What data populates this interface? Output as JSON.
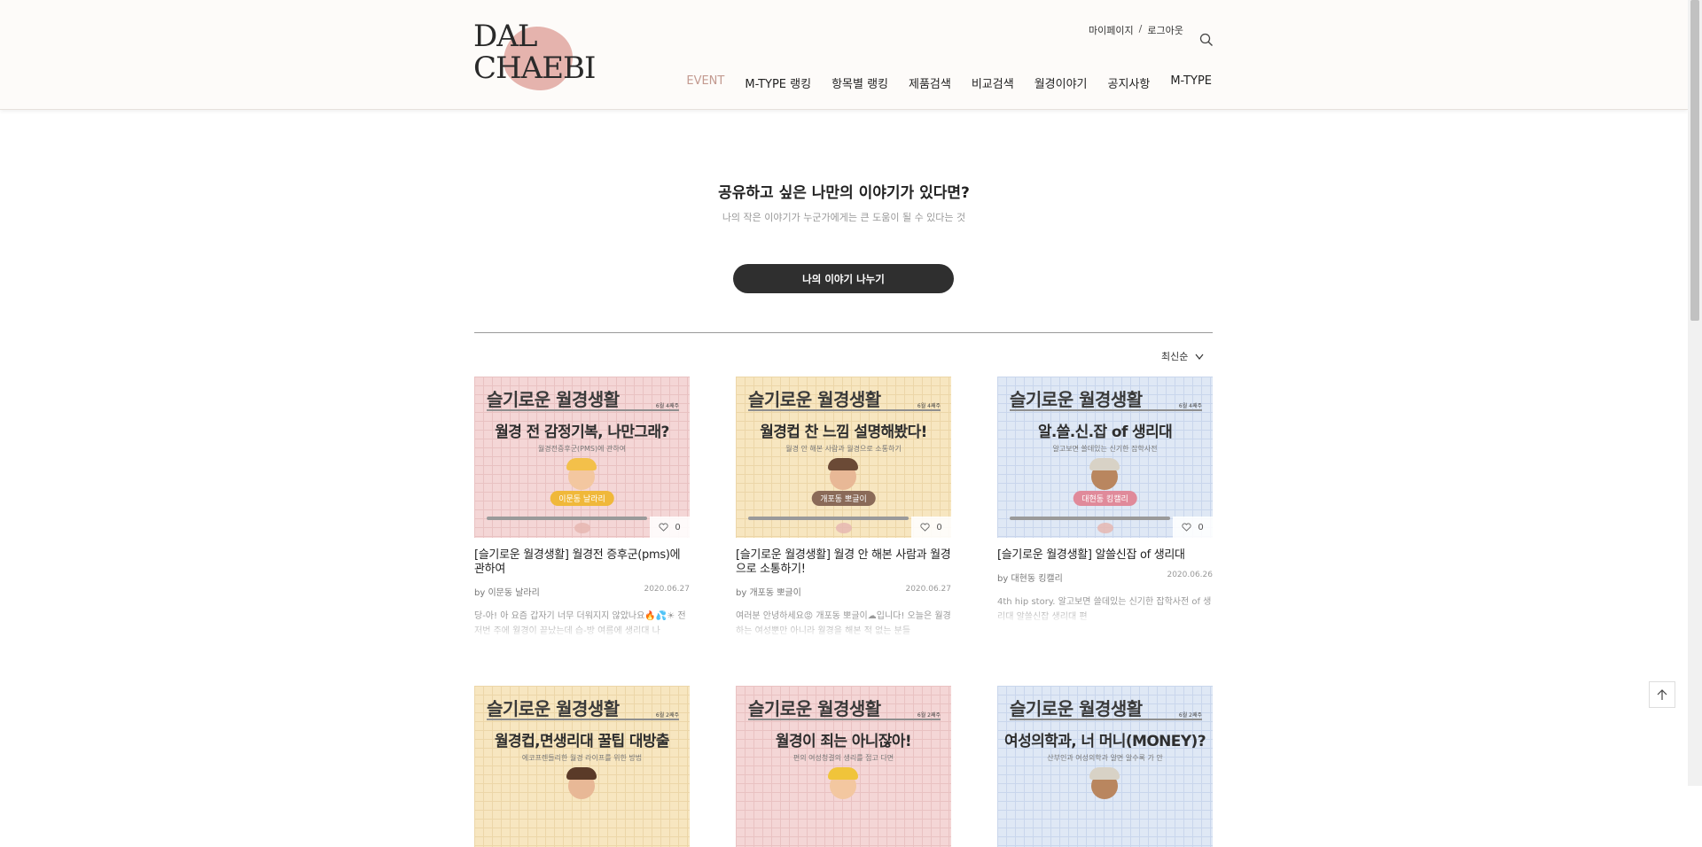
{
  "brand": {
    "logo_line1": "DAL",
    "logo_line2": "CHAEBI",
    "accent": "#c39a90",
    "logo_blob": "#e5b3ad"
  },
  "top_links": {
    "mypage": "마이페이지",
    "separator": "/",
    "logout": "로그아웃"
  },
  "nav": [
    {
      "label": "EVENT",
      "active": true
    },
    {
      "label": "M-TYPE 랭킹"
    },
    {
      "label": "항목별 랭킹"
    },
    {
      "label": "제품검색"
    },
    {
      "label": "비교검색"
    },
    {
      "label": "월경이야기"
    },
    {
      "label": "공지사항"
    },
    {
      "label": "M-TYPE"
    }
  ],
  "hero": {
    "title": "공유하고 싶은 나만의 이야기가 있다면?",
    "subtitle": "나의 작은 이야기가 누군가에게는 큰 도움이 될 수 있다는 것",
    "button": "나의 이야기 나누기"
  },
  "sort": {
    "label": "최신순"
  },
  "cards": [
    {
      "theme": "pink",
      "series": "슬기로운 월경생활",
      "week": "6월 4째주",
      "headline": "월경 전 감정기복, 나만그래?",
      "sub": "월경전증후군(PMS)에 관하여",
      "tag": "이문동 날라리",
      "tag_color": "#f0b83a",
      "avatar_color": "#f3c04a",
      "likes": "0",
      "title": "[슬기로운 월경생활] 월경전 증후군(pms)에 관하여",
      "author": "by 이문동 날라리",
      "date": "2020.06.27",
      "excerpt": "당-아! 아 요즘 갑자기 너무 더워지지 않았나요🔥💦☀ 전 저번 주에 월경이 끝났는데 습-방 여름에 생리대 나"
    },
    {
      "theme": "yellow",
      "series": "슬기로운 월경생활",
      "week": "6월 4째주",
      "headline": "월경컵 찬 느낌 설명해봤다!",
      "sub": "월경 안 해본 사람과 월경으로 소통하기",
      "tag": "개포동 뽀글이",
      "tag_color": "#8a6a58",
      "avatar_color": "#6b4a36",
      "likes": "0",
      "title": "[슬기로운 월경생활] 월경 안 해본 사람과 월경으로 소통하기!",
      "author": "by 개포동 뽀글이",
      "date": "2020.06.27",
      "excerpt": "여러분 안녕하세요😡 개포동 뽀글이☁입니다! 오늘은 월경하는 여성뿐만 아니라 월경을 해본 적 없는 분들"
    },
    {
      "theme": "blue",
      "series": "슬기로운 월경생활",
      "week": "6월 4째주",
      "headline": "알.쓸.신.잡 of 생리대",
      "sub": "알고보면 쓸데있는 신기한 잡학사전",
      "tag": "대현동 킹캘리",
      "tag_color": "#e08a9a",
      "avatar_color": "#d8d2c6",
      "likes": "0",
      "title": "[슬기로운 월경생활] 알쓸신잡 of 생리대",
      "author": "by 대현동 킹캘리",
      "date": "2020.06.26",
      "excerpt": "4th hip story. 알고보면 쓸데있는 신기한 잡학사전 of 생리대 알쓸신잡 생리대 편"
    },
    {
      "theme": "yellow",
      "series": "슬기로운 월경생활",
      "week": "6월 2째주",
      "headline": "월경컵,면생리대 꿀팁 대방출",
      "sub": "에코프렌들리한 월경 라이프를 위한 방법"
    },
    {
      "theme": "pink",
      "series": "슬기로운 월경생활",
      "week": "6월 2째주",
      "headline": "월경이 죄는 아니잖아!",
      "sub": "편의 여성청결의 생리를 접고 다면"
    },
    {
      "theme": "blue",
      "series": "슬기로운 월경생활",
      "week": "6월 2째주",
      "headline": "여성의학과, 너 머니(MONEY)?",
      "sub": "산부인과 여성의학과 알면 알수록 가 안"
    }
  ]
}
